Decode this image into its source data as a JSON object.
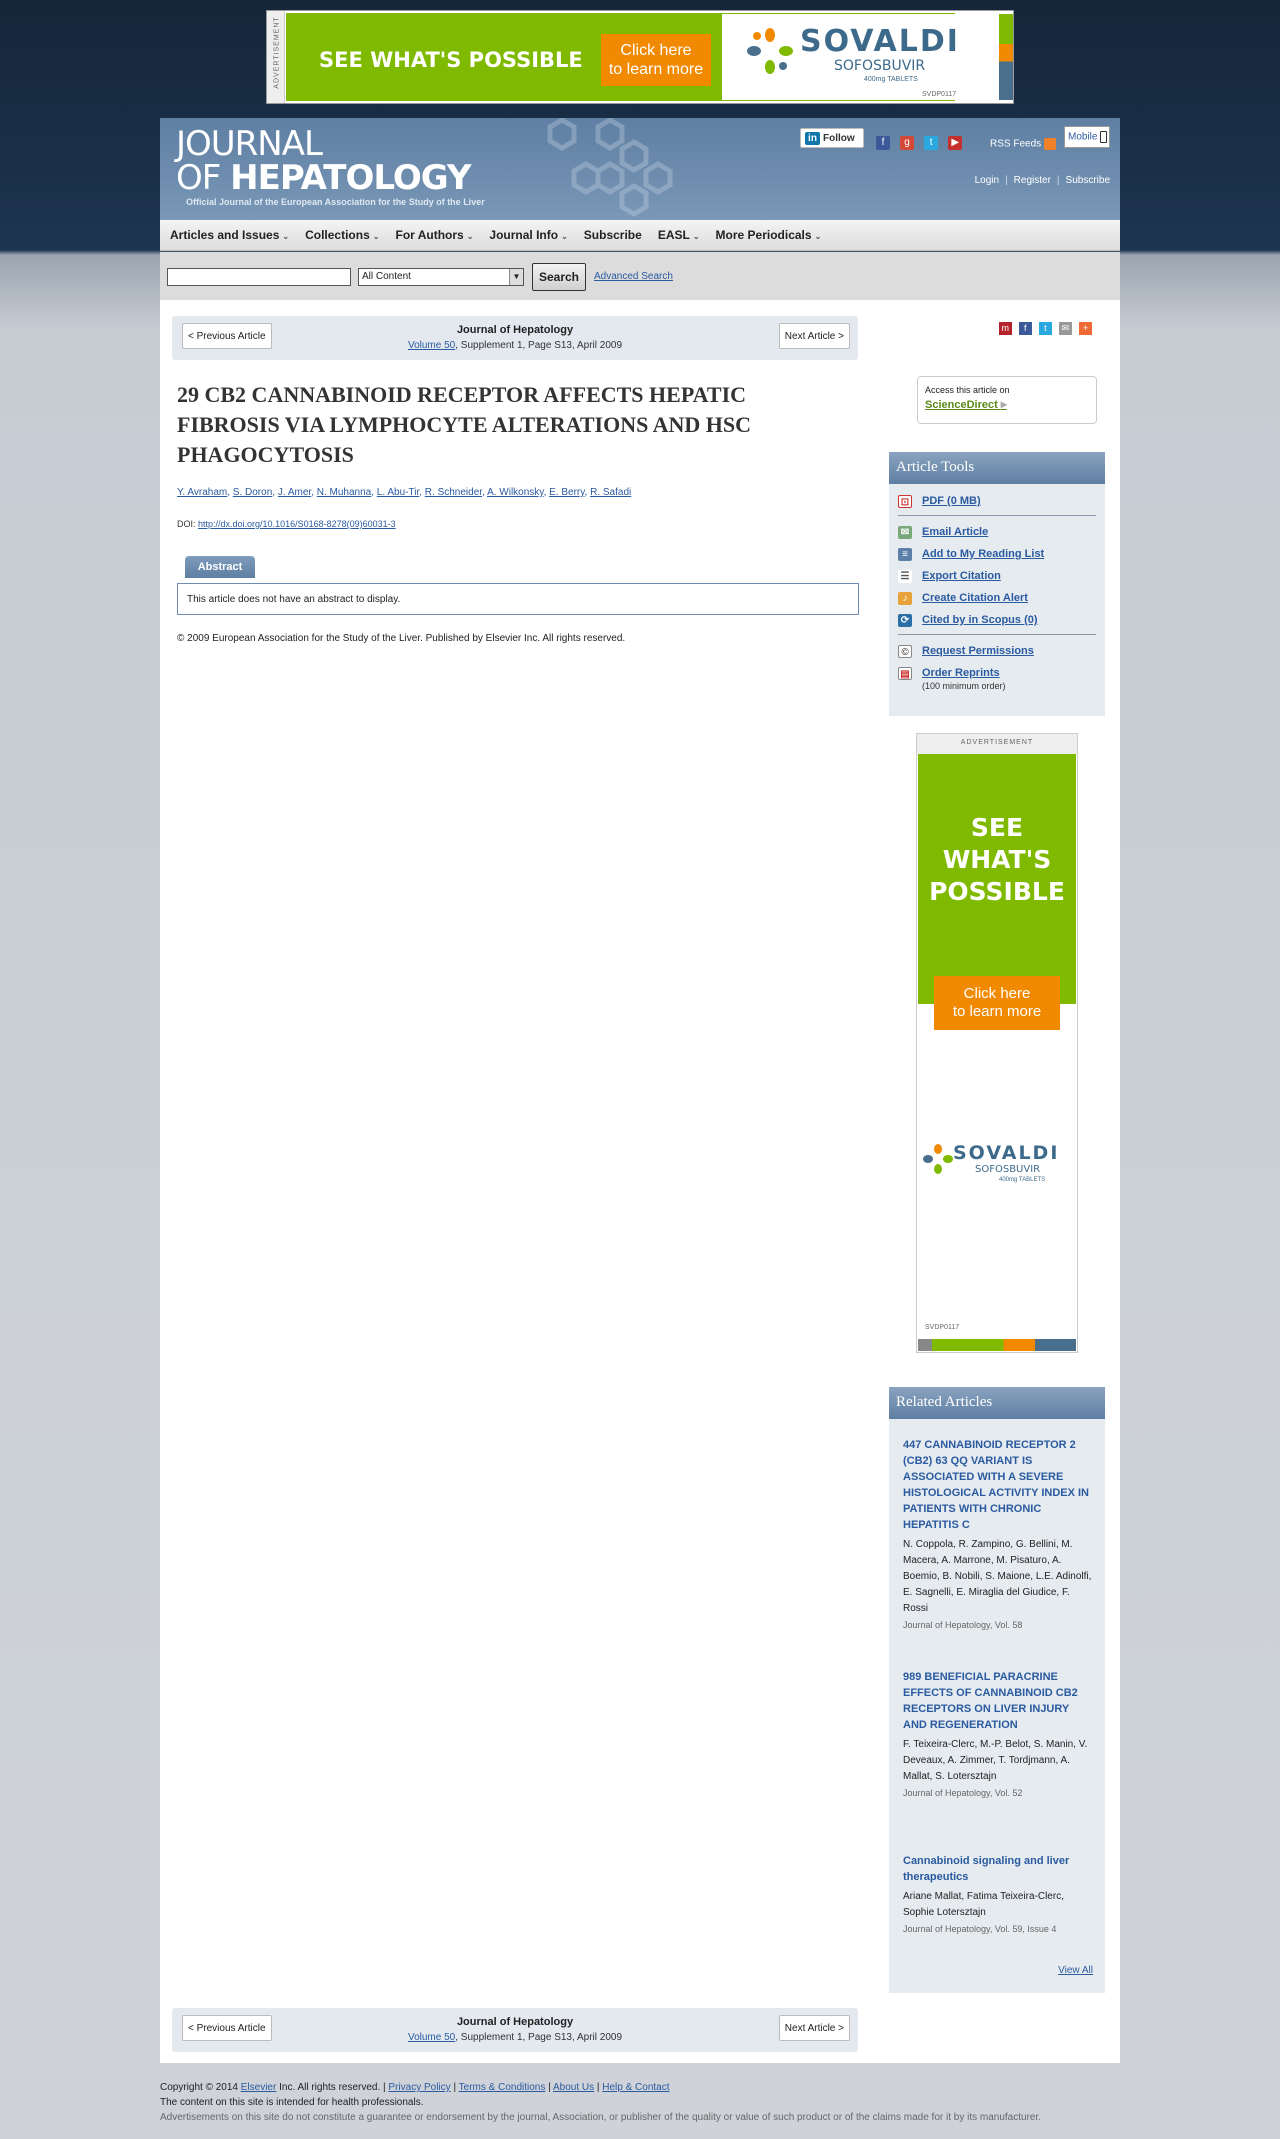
{
  "top_ad": {
    "label": "ADVERTISEMENT",
    "headline": "SEE WHAT'S POSSIBLE",
    "cta_line1": "Click here",
    "cta_line2": "to learn more",
    "brand": "SOVALDI",
    "generic": "SOFOSBUVIR",
    "dose": "400mg TABLETS",
    "code": "SVDP0117",
    "colors": {
      "green": "#7fba00",
      "orange": "#f18a00",
      "blue": "#3d6a8b"
    }
  },
  "header": {
    "brand_line1": "JOURNAL",
    "brand_line2_prefix": "OF ",
    "brand_line2_bold": "HEPATOLOGY",
    "subtitle": "Official Journal of the European Association for the Study of the Liver",
    "follow": "Follow",
    "rss": "RSS Feeds",
    "mobile": "Mobile",
    "login": "Login",
    "register": "Register",
    "subscribe": "Subscribe"
  },
  "nav": {
    "items": [
      "Articles and Issues",
      "Collections",
      "For Authors",
      "Journal Info",
      "Subscribe",
      "EASL",
      "More Periodicals"
    ]
  },
  "search": {
    "scope": "All Content",
    "button": "Search",
    "advanced": "Advanced Search"
  },
  "article_nav": {
    "prev": "< Previous Article",
    "next": "Next Article >",
    "journal": "Journal of Hepatology",
    "volume": "Volume 50",
    "rest": ", Supplement 1, Page S13, April 2009"
  },
  "article": {
    "title": "29 CB2 CANNABINOID RECEPTOR AFFECTS HEPATIC FIBROSIS VIA LYMPHOCYTE ALTERATIONS AND HSC PHAGOCYTOSIS",
    "authors": [
      "Y. Avraham",
      "S. Doron",
      "J. Amer",
      "N. Muhanna",
      "L. Abu-Tir",
      "R. Schneider",
      "A. Wilkonsky",
      "E. Berry",
      "R. Safadi"
    ],
    "doi_label": "DOI: ",
    "doi": "http://dx.doi.org/10.1016/S0168-8278(09)60031-3",
    "abstract_tab": "Abstract",
    "abstract_text": "This article does not have an abstract to display.",
    "copyright": "© 2009 European Association for the Study of the Liver. Published by Elsevier Inc. All rights reserved."
  },
  "sciencedirect": {
    "line1": "Access this article on",
    "link": "ScienceDirect"
  },
  "tools": {
    "title": "Article Tools",
    "items": [
      "PDF (0 MB)",
      "Email Article",
      "Add to My Reading List",
      "Export Citation",
      "Create Citation Alert",
      "Cited by in Scopus (0)",
      "Request Permissions",
      "Order Reprints"
    ],
    "reprints_note": "(100 minimum order)"
  },
  "side_ad": {
    "label": "ADVERTISEMENT",
    "headline1": "SEE",
    "headline2": "WHAT'S",
    "headline3": "POSSIBLE",
    "cta_line1": "Click here",
    "cta_line2": "to learn more",
    "brand": "SOVALDI",
    "generic": "SOFOSBUVIR",
    "dose": "400mg TABLETS",
    "code": "SVDP0117"
  },
  "related": {
    "title": "Related Articles",
    "items": [
      {
        "title": "447 CANNABINOID RECEPTOR 2 (CB2) 63 QQ VARIANT IS ASSOCIATED WITH A SEVERE HISTOLOGICAL ACTIVITY INDEX IN PATIENTS WITH CHRONIC HEPATITIS C",
        "authors": "N. Coppola, R. Zampino, G. Bellini, M. Macera, A. Marrone, M. Pisaturo, A. Boemio, B. Nobili, S. Maione, L.E. Adinolfi, E. Sagnelli, E. Miraglia del Giudice, F. Rossi",
        "source": "Journal of Hepatology, Vol. 58"
      },
      {
        "title": "989 BENEFICIAL PARACRINE EFFECTS OF CANNABINOID CB2 RECEPTORS ON LIVER INJURY AND REGENERATION",
        "authors": "F. Teixeira-Clerc, M.-P. Belot, S. Manin, V. Deveaux, A. Zimmer, T. Tordjmann, A. Mallat, S. Lotersztajn",
        "source": "Journal of Hepatology, Vol. 52"
      },
      {
        "title": "Cannabinoid signaling and liver therapeutics",
        "authors": "Ariane Mallat, Fatima Teixeira-Clerc, Sophie Lotersztajn",
        "source": "Journal of Hepatology, Vol. 59, Issue 4"
      }
    ],
    "view_all": "View All"
  },
  "footer": {
    "copyright": "Copyright © 2014 ",
    "elsevier": "Elsevier",
    "rights": " Inc. All rights reserved. | ",
    "privacy": "Privacy Policy",
    "terms": "Terms & Conditions",
    "about": "About Us",
    "help": "Help & Contact",
    "notice": "The content on this site is intended for health professionals.",
    "disclaimer": "Advertisements on this site do not constitute a guarantee or endorsement by the journal, Association, or publisher of the quality or value of such product or of the claims made for it by its manufacturer."
  }
}
